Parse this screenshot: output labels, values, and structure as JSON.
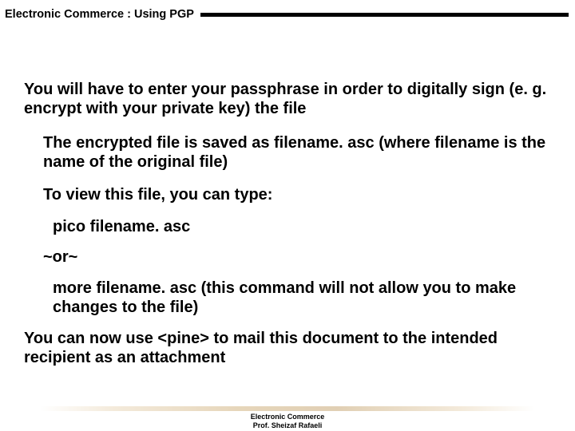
{
  "header": {
    "title": "Electronic Commerce :  Using PGP"
  },
  "content": {
    "p1": "You will have to enter your passphrase in order to digitally sign (e. g. encrypt with your private key) the file",
    "p2": "The encrypted file is saved as filename. asc (where filename is the name of the original file)",
    "p3": "To view this file, you can type:",
    "p4": "pico filename. asc",
    "p5": "~or~",
    "p6": "more filename. asc (this command will not allow you to make changes to the file)",
    "p7": "You can now use <pine> to mail this document to the intended recipient as an attachment"
  },
  "footer": {
    "line1": "Electronic Commerce",
    "line2": "Prof. Sheizaf Rafaeli"
  }
}
